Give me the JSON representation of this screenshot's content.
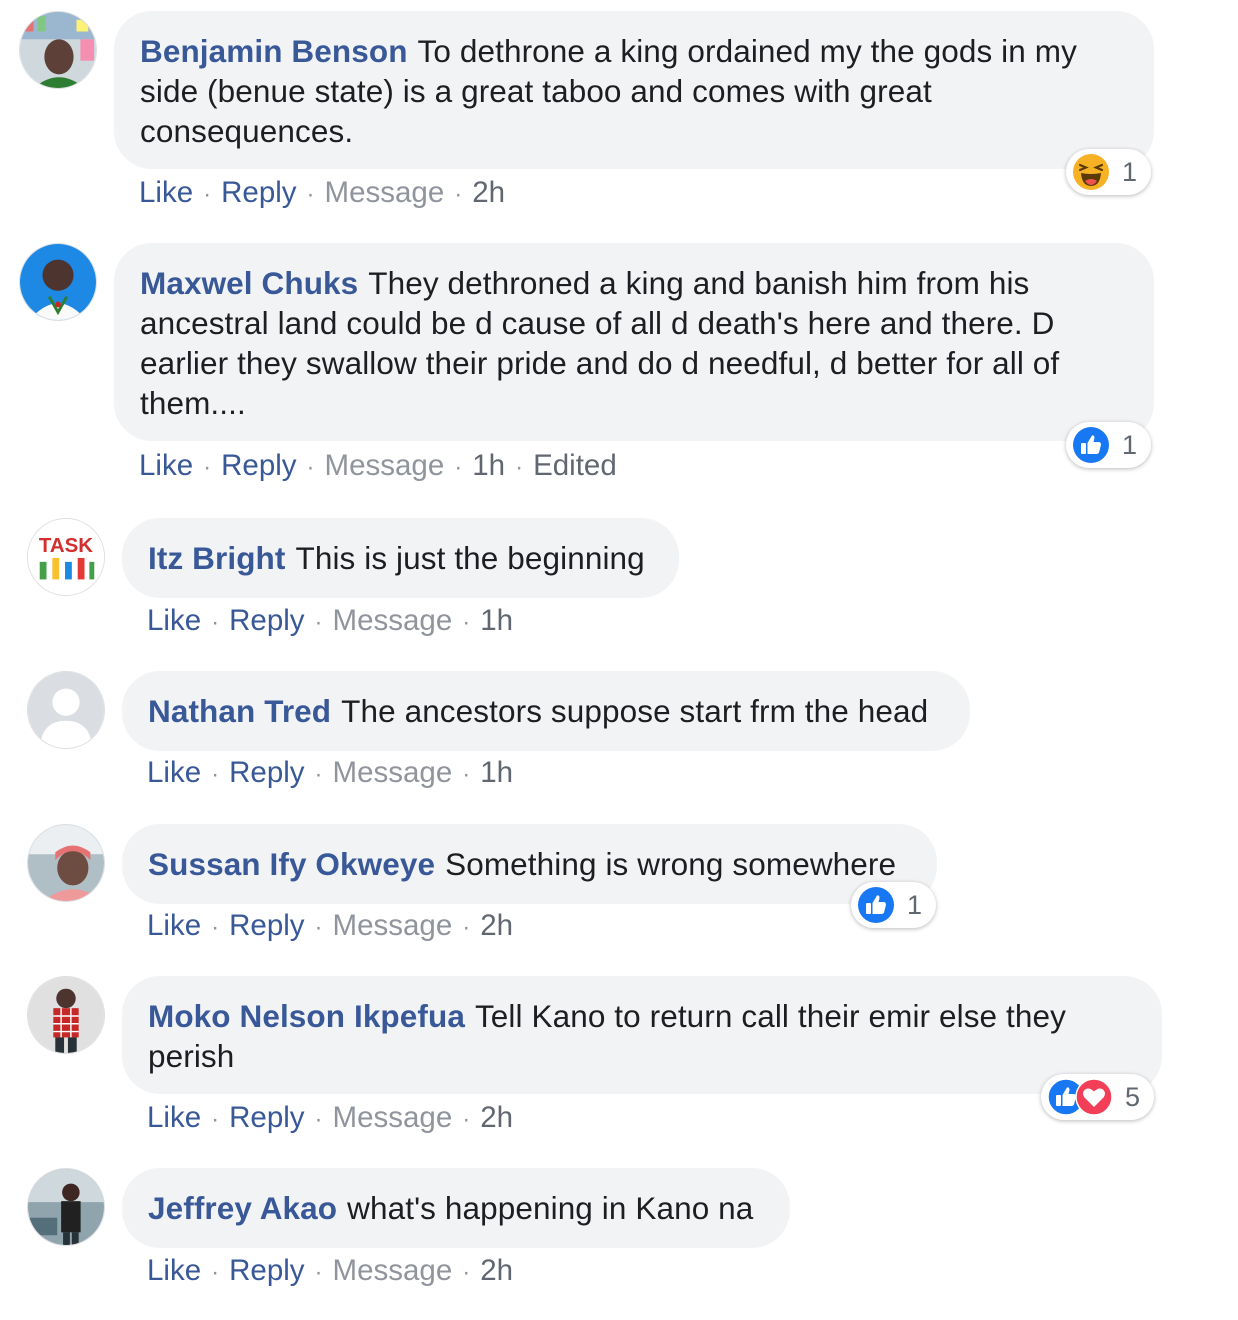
{
  "colors": {
    "author": "#385898",
    "link": "#385898",
    "muted": "#90949c",
    "bubble": "#f2f3f5",
    "like_blue": "#1877f2",
    "love_red": "#f33e58",
    "haha_yellow": "#f7b125"
  },
  "actions": {
    "like": "Like",
    "reply": "Reply",
    "message": "Message",
    "sep": "·"
  },
  "comments": [
    {
      "author": "Benjamin Benson",
      "text": "To dethrone a king ordained my the gods in my side (benue state) is a great taboo and comes with great consequences.",
      "time": "2h",
      "edited": "",
      "reaction": {
        "icons": [
          "haha-icon"
        ],
        "count": "1"
      }
    },
    {
      "author": "Maxwel Chuks",
      "text": "They dethroned a king and banish him from his ancestral land could be d cause of all d death's here and there. D earlier they swallow their pride and do d needful, d better for all of them....",
      "time": "1h",
      "edited": "Edited",
      "reaction": {
        "icons": [
          "like-icon"
        ],
        "count": "1"
      }
    },
    {
      "author": "Itz Bright",
      "text": "This is just the beginning",
      "time": "1h",
      "edited": "",
      "avatar_text": "TASK"
    },
    {
      "author": "Nathan Tred",
      "text": "The ancestors suppose start frm the head",
      "time": "1h",
      "edited": ""
    },
    {
      "author": "Sussan Ify Okweye",
      "text": "Something is wrong somewhere",
      "time": "2h",
      "edited": "",
      "reaction": {
        "icons": [
          "like-icon"
        ],
        "count": "1"
      }
    },
    {
      "author": "Moko Nelson Ikpefua",
      "text": "Tell Kano to return call their emir else they perish",
      "time": "2h",
      "edited": "",
      "reaction": {
        "icons": [
          "like-icon",
          "love-icon"
        ],
        "count": "5"
      }
    },
    {
      "author": "Jeffrey Akao",
      "text": "what's happening in Kano na",
      "time": "2h",
      "edited": ""
    }
  ]
}
